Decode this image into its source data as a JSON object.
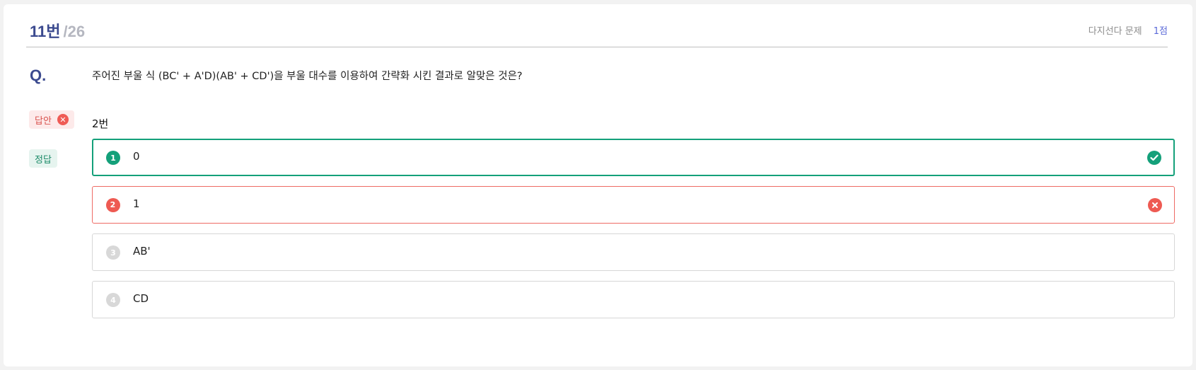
{
  "header": {
    "question_number": "11번",
    "total": "/26",
    "question_type": "다지선다 문제",
    "points": "1점"
  },
  "question": {
    "label": "Q.",
    "text": "주어진 부울 식 (BC' + A'D)(AB' + CD')을 부울 대수를 이용하여 간략화 시킨 결과로 알맞은 것은?"
  },
  "answer": {
    "tag_label": "답안",
    "value": "2번"
  },
  "correct": {
    "tag_label": "정답"
  },
  "options": [
    {
      "number": "1",
      "text": "0",
      "state": "correct"
    },
    {
      "number": "2",
      "text": "1",
      "state": "wrong"
    },
    {
      "number": "3",
      "text": "AB'",
      "state": "neutral"
    },
    {
      "number": "4",
      "text": "CD",
      "state": "neutral"
    }
  ],
  "colors": {
    "accent": "#3b4a8f",
    "correct": "#14a07a",
    "wrong": "#ee5a52"
  }
}
